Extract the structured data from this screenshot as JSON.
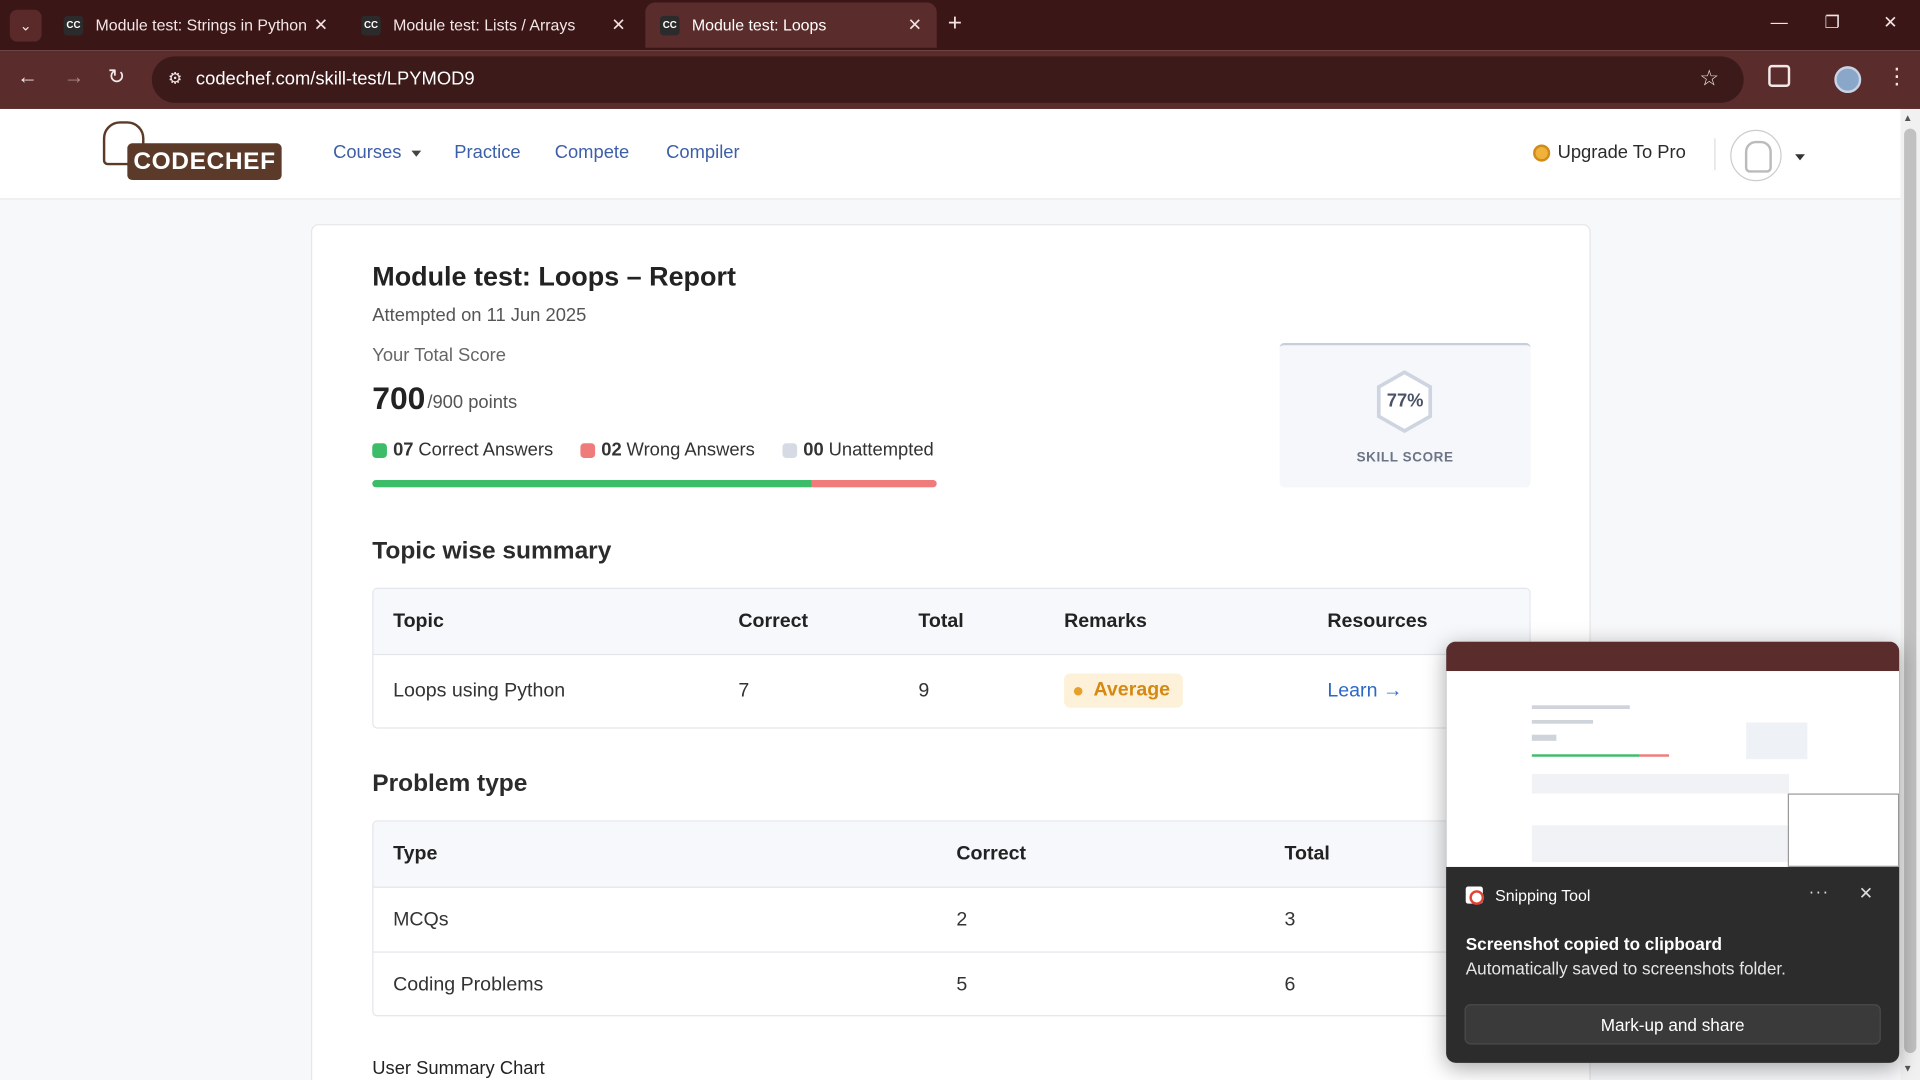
{
  "browser": {
    "tabs": [
      {
        "label": "Module test: Strings in Python",
        "favicon": "CC"
      },
      {
        "label": "Module test: Lists / Arrays",
        "favicon": "CC"
      },
      {
        "label": "Module test: Loops",
        "favicon": "CC"
      }
    ],
    "active_tab": 2,
    "url": "codechef.com/skill-test/LPYMOD9"
  },
  "site": {
    "logo_text": "CODECHEF",
    "nav": [
      "Courses",
      "Practice",
      "Compete",
      "Compiler"
    ],
    "upgrade_label": "Upgrade To Pro"
  },
  "report": {
    "title": "Module test: Loops – Report",
    "attempted": "Attempted on 11 Jun 2025",
    "score_label": "Your Total Score",
    "score": "700",
    "score_total": "/900 points",
    "correct_count": "07",
    "correct_label": "Correct Answers",
    "wrong_count": "02",
    "wrong_label": "Wrong Answers",
    "unattempted_count": "00",
    "unattempted_label": "Unattempted",
    "progress": {
      "correct": 7,
      "wrong": 2,
      "unattempted": 0,
      "total": 9
    },
    "skill_score": "77%",
    "skill_label": "SKILL SCORE"
  },
  "topic_summary": {
    "title": "Topic wise summary",
    "headers": [
      "Topic",
      "Correct",
      "Total",
      "Remarks",
      "Resources"
    ],
    "rows": [
      {
        "topic": "Loops using Python",
        "correct": "7",
        "total": "9",
        "remark": "Average",
        "resource": "Learn →"
      }
    ]
  },
  "problem_type": {
    "title": "Problem type",
    "headers": [
      "Type",
      "Correct",
      "Total"
    ],
    "rows": [
      {
        "type": "MCQs",
        "correct": "2",
        "total": "3"
      },
      {
        "type": "Coding Problems",
        "correct": "5",
        "total": "6"
      }
    ]
  },
  "chart_section_title": "User Summary Chart",
  "toast": {
    "app": "Snipping Tool",
    "message": "Screenshot copied to clipboard",
    "sub": "Automatically saved to screenshots folder.",
    "button": "Mark-up and share"
  },
  "colors": {
    "correct": "#3dbd6a",
    "wrong": "#ef7b7b",
    "unattempted": "#d5dae4",
    "average": "#d48a12",
    "link": "#3d5fa8",
    "chrome": "#5b2c2c"
  }
}
